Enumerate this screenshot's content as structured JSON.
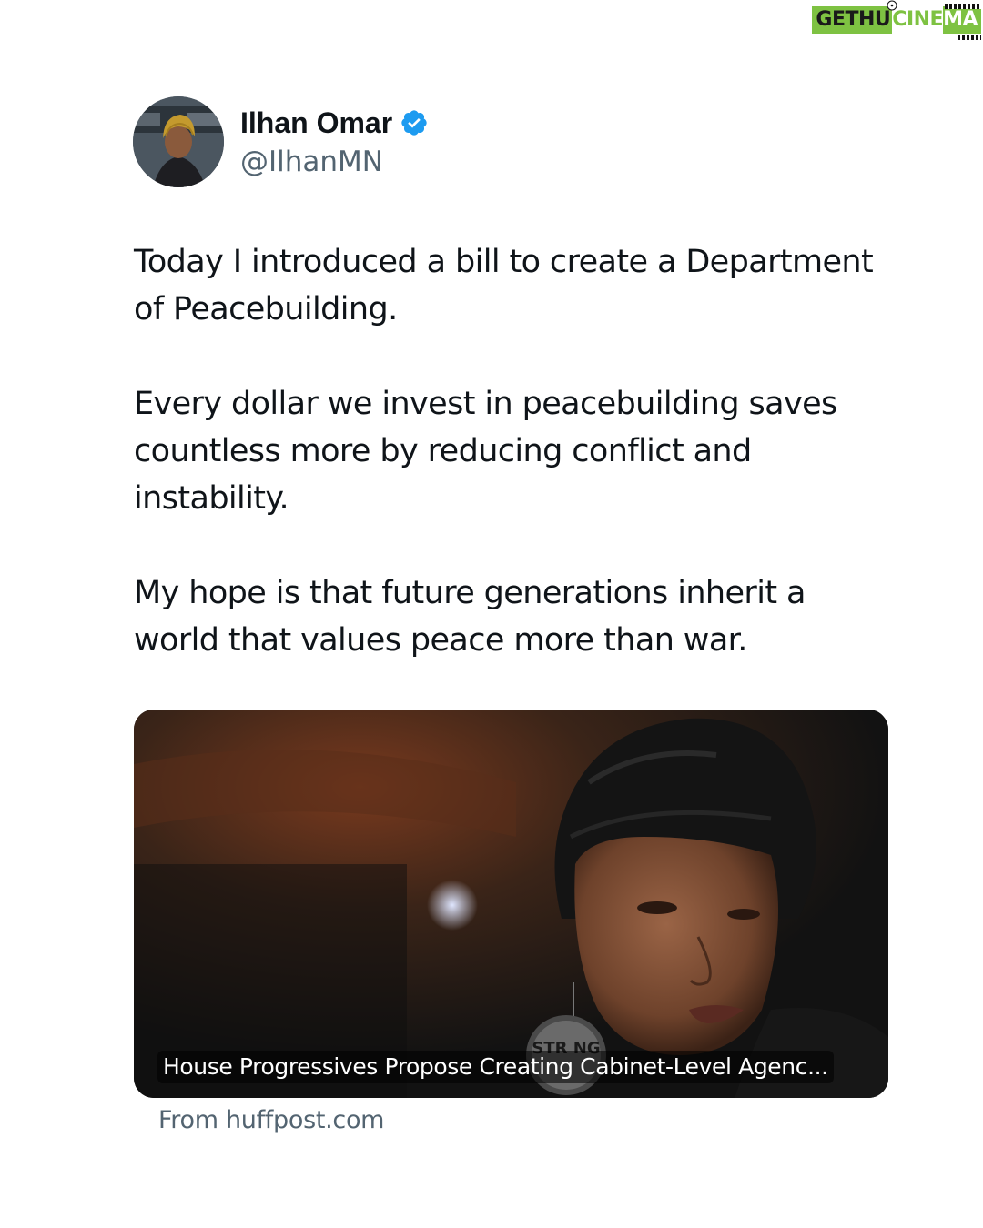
{
  "watermark": {
    "part_a": "GETHU",
    "part_b": "CINE",
    "part_c": "MA"
  },
  "tweet": {
    "author_name": "Ilhan Omar",
    "author_handle": "@IlhanMN",
    "verified": true,
    "paragraphs": [
      "Today I introduced a bill to create a Department\nof Peacebuilding.",
      "Every dollar we invest in peacebuilding saves\ncountless more by reducing conflict and\ninstability.",
      "My hope is that future generations inherit a\nworld that values peace more than war."
    ],
    "link_card": {
      "headline": "House Progressives Propose Creating Cabinet-Level Agenc...",
      "source": "From huffpost.com",
      "earring_text": "STR NG"
    }
  },
  "colors": {
    "text_primary": "#0f1419",
    "text_secondary": "#536471",
    "verified_blue": "#1d9bf0",
    "watermark_green": "#7ec242"
  }
}
